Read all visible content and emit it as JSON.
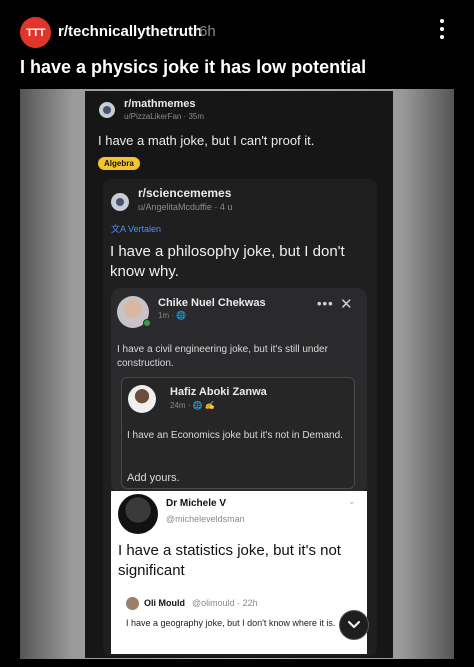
{
  "post": {
    "subreddit_avatar_text": "TTT",
    "subreddit": "r/technicallythetruth",
    "age": "6h",
    "title": "I have a physics joke it has low potential"
  },
  "math_post": {
    "subreddit": "r/mathmemes",
    "user_meta": "u/PizzaLikerFan · 35m",
    "text": "I have a math joke, but I can't proof it.",
    "flair": "Algebra"
  },
  "science_post": {
    "subreddit": "r/sciencememes",
    "user_meta": "u/AngelitaMcduffie · 4 u",
    "translate": "Vertalen",
    "text": "I have a philosophy joke, but I don't know why."
  },
  "fb_post": {
    "name": "Chike Nuel Chekwas",
    "meta": "1m · ",
    "dots": "•••",
    "close": "✕",
    "text": "I have a civil engineering joke, but it's still under construction."
  },
  "tweet_econ": {
    "name": "Hafiz Aboki Zanwa",
    "meta": "24m · ",
    "text": "I have an Economics joke but it's not in Demand.",
    "add_yours": "Add yours."
  },
  "tweet_stats": {
    "name": "Dr Michele V",
    "handle": "@micheleveldsman",
    "text": "I have a statistics joke, but it's not significant"
  },
  "tweet_geo": {
    "name": "Oli Mould",
    "meta": "@olimould · 22h",
    "text": "I have a geography joke, but I don't know where it is."
  },
  "colors": {
    "subreddit_avatar": "#e0352b",
    "flair": "#f4c430",
    "translate_link": "#4f8cff"
  }
}
